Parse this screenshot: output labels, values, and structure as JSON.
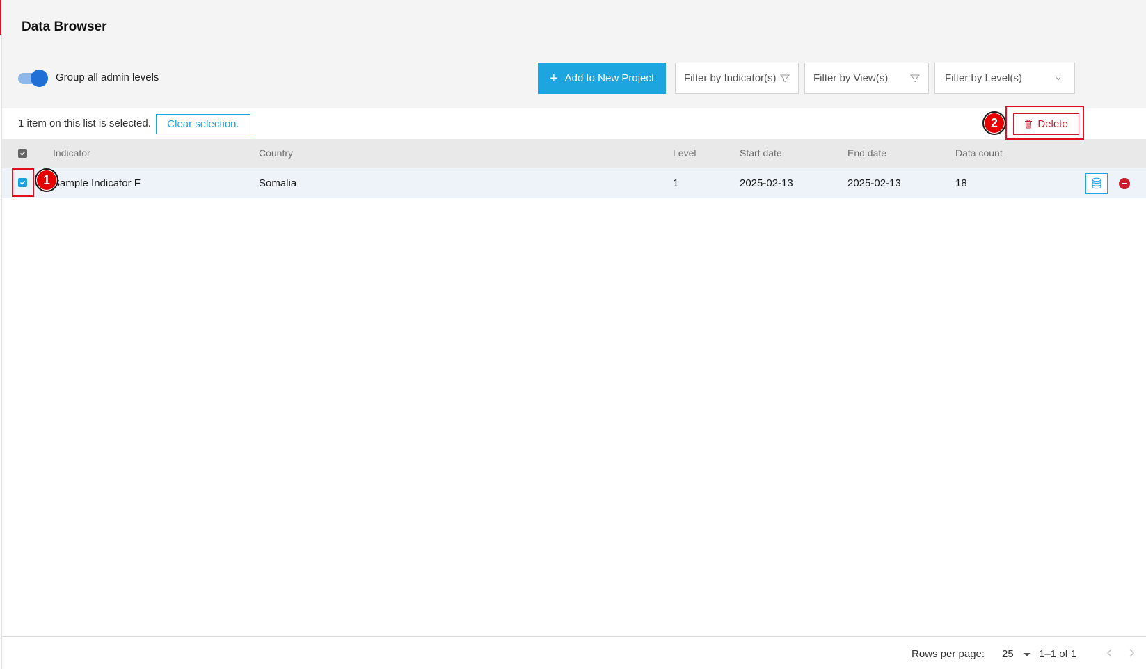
{
  "header": {
    "title": "Data Browser",
    "group_toggle_label": "Group all admin levels",
    "group_toggle_on": true,
    "add_button_label": "Add to New Project",
    "filters": {
      "indicator_placeholder": "Filter by Indicator(s)",
      "view_placeholder": "Filter by View(s)",
      "level_placeholder": "Filter by Level(s)"
    }
  },
  "selection": {
    "status_text": "1 item on this list is selected.",
    "clear_label": "Clear selection.",
    "delete_label": "Delete"
  },
  "table": {
    "columns": [
      "Indicator",
      "Country",
      "Level",
      "Start date",
      "End date",
      "Data count"
    ],
    "rows": [
      {
        "indicator": "Sample Indicator F",
        "country": "Somalia",
        "level": "1",
        "start_date": "2025-02-13",
        "end_date": "2025-02-13",
        "data_count": "18",
        "selected": true
      }
    ]
  },
  "annotations": {
    "marker_1": "1",
    "marker_2": "2"
  },
  "pagination": {
    "rows_per_page_label": "Rows per page:",
    "rows_per_page_value": "25",
    "range_text": "1–1 of 1"
  },
  "colors": {
    "accent": "#1da5e0",
    "danger": "#d0182c",
    "toggle": "#1f6fd6",
    "highlight": "#e0101e"
  }
}
